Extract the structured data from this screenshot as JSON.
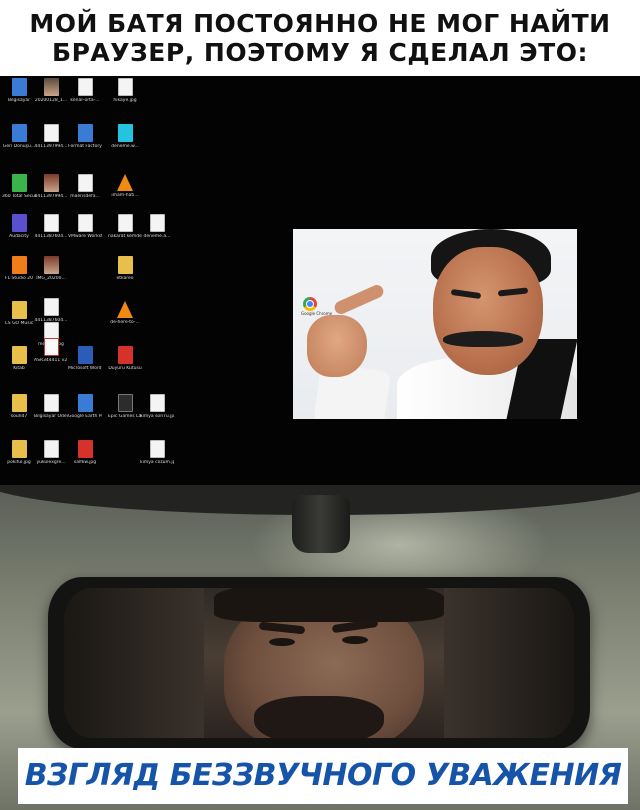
{
  "top_caption": {
    "line1": "МОЙ БАТЯ ПОСТОЯННО НЕ МОГ НАЙТИ",
    "line2": "БРАУЗЕР, ПОЭТОМУ Я СДЕЛАЛ ЭТО:"
  },
  "desktop": {
    "icons": [
      {
        "label": "Bilgisayar",
        "icon": "computer-icon",
        "color": "#3a7bd5"
      },
      {
        "label": "20200128_1...",
        "icon": "photo-icon",
        "color": "#5a4a3a"
      },
      {
        "label": "kenar-orta-...",
        "icon": "document-icon",
        "color": "#f4f4f4"
      },
      {
        "label": "hikaye.jpg",
        "icon": "document-icon",
        "color": "#f4f4f4"
      },
      {
        "label": "Geri Dönüşü...",
        "icon": "recycle-bin-icon",
        "color": "#7ab8e8"
      },
      {
        "label": "4411397994...",
        "icon": "document-icon",
        "color": "#f4f4f4"
      },
      {
        "label": "Format Factory",
        "icon": "format-factory-icon",
        "color": "#3a7bd5"
      },
      {
        "label": "deneme.w...",
        "icon": "audio-file-icon",
        "color": "#24c4e0"
      },
      {
        "label": "360 Total Security",
        "icon": "shield-plus-icon",
        "color": "#3bb44a"
      },
      {
        "label": "4411397994...",
        "icon": "photo-icon",
        "color": "#7b3a2a"
      },
      {
        "label": "maerisdefa...",
        "icon": "document-icon",
        "color": "#f4f4f4"
      },
      {
        "label": "imam-hati...",
        "icon": "vlc-icon",
        "color": "#f08a12"
      },
      {
        "label": "Audacity",
        "icon": "audacity-icon",
        "color": "#5a4fcf"
      },
      {
        "label": "4411387604...",
        "icon": "document-icon",
        "color": "#f4f4f4"
      },
      {
        "label": "VMware Workstati...",
        "icon": "vmware-icon",
        "color": "#f4f4f4"
      },
      {
        "label": "nakarat kemdelt",
        "icon": "document-icon",
        "color": "#f4f4f4"
      },
      {
        "label": "deneme.a...",
        "icon": "document-icon",
        "color": "#f4f4f4"
      },
      {
        "label": "FL Studio 20",
        "icon": "fl-studio-icon",
        "color": "#f07d1a"
      },
      {
        "label": "IMG_20200...",
        "icon": "photo-icon",
        "color": "#7b3a2a"
      },
      {
        "label": "etkareo",
        "icon": "winrar-icon",
        "color": "#e9bf4c"
      },
      {
        "label": "4411387604...",
        "icon": "document-icon",
        "color": "#f4f4f4"
      },
      {
        "label": "CS GO Music",
        "icon": "folder-icon",
        "color": "#e9bf4c"
      },
      {
        "label": "mebum.jpg",
        "icon": "document-icon",
        "color": "#f4f4f4"
      },
      {
        "label": "de-here-to-...",
        "icon": "vlc-icon",
        "color": "#f08a12"
      },
      {
        "label": "ASR344411 v2 instruction...",
        "icon": "pdf-icon",
        "color": "#fafafa"
      },
      {
        "label": "Kitab",
        "icon": "folder-icon",
        "color": "#e9bf4c"
      },
      {
        "label": "Microsoft Word 2010",
        "icon": "word-icon",
        "color": "#2b5cb8"
      },
      {
        "label": "Duyuru Kutusu",
        "icon": "app-icon",
        "color": "#d6322c"
      },
      {
        "label": "sound7",
        "icon": "folder-icon",
        "color": "#e9bf4c"
      },
      {
        "label": "Bilgisayar Ödevi.txt",
        "icon": "document-icon",
        "color": "#f4f4f4"
      },
      {
        "label": "Google Earth Pro",
        "icon": "google-earth-icon",
        "color": "#3a7bd5"
      },
      {
        "label": "Epic Games Launcher",
        "icon": "epic-games-icon",
        "color": "#2c2c2c"
      },
      {
        "label": "kimya son7u.jpg",
        "icon": "document-icon",
        "color": "#f4f4f4"
      },
      {
        "label": "pokiful.jpg",
        "icon": "folder-icon",
        "color": "#f07d1a"
      },
      {
        "label": "yukulexgre...",
        "icon": "document-icon",
        "color": "#f4f4f4"
      },
      {
        "label": "salfkw.jpg",
        "icon": "app-icon",
        "color": "#2aa6a4"
      },
      {
        "label": "kimya cözüm.jpg",
        "icon": "document-icon",
        "color": "#f4f4f4"
      }
    ],
    "chrome_shortcut": {
      "label": "Google Chrome",
      "icon": "chrome-icon"
    }
  },
  "bottom_caption": "ВЗГЛЯД БЕЗЗВУЧНОГО УВАЖЕНИЯ",
  "colors": {
    "caption_blue": "#1554a8",
    "desktop_bg": "#030303"
  }
}
